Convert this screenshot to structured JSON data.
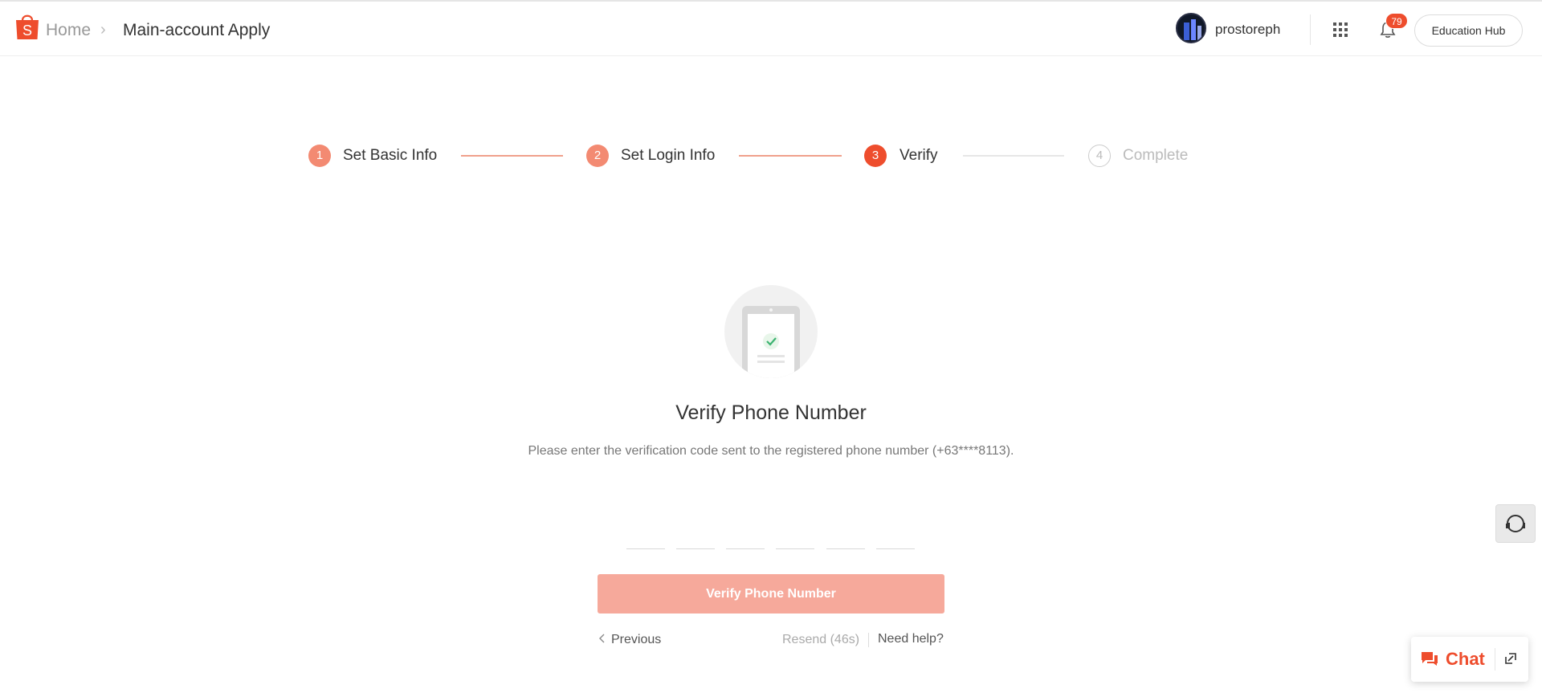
{
  "header": {
    "breadcrumb": {
      "home": "Home",
      "separator": "›",
      "current": "Main-account Apply"
    },
    "username": "prostoreph",
    "notification_count": "79",
    "education_hub_label": "Education Hub",
    "brand_color": "#ee4d2d"
  },
  "stepper": {
    "steps": [
      {
        "number": "1",
        "label": "Set Basic Info",
        "state": "done"
      },
      {
        "number": "2",
        "label": "Set Login Info",
        "state": "done"
      },
      {
        "number": "3",
        "label": "Verify",
        "state": "active"
      },
      {
        "number": "4",
        "label": "Complete",
        "state": "pending"
      }
    ]
  },
  "verify": {
    "title": "Verify Phone Number",
    "description": "Please enter the verification code sent to the registered phone number (+63****8113).",
    "code_digits": [
      "",
      "",
      "",
      "",
      "",
      ""
    ],
    "submit_label": "Verify Phone Number",
    "previous_label": "Previous",
    "resend_label": "Resend (46s)",
    "help_label": "Need help?"
  },
  "chat": {
    "label": "Chat"
  },
  "icons": {
    "logo": "shopee-bag-icon",
    "apps": "apps-grid-icon",
    "bell": "bell-icon",
    "support": "headset-icon",
    "chat": "chat-bubble-icon",
    "expand": "expand-icon"
  }
}
